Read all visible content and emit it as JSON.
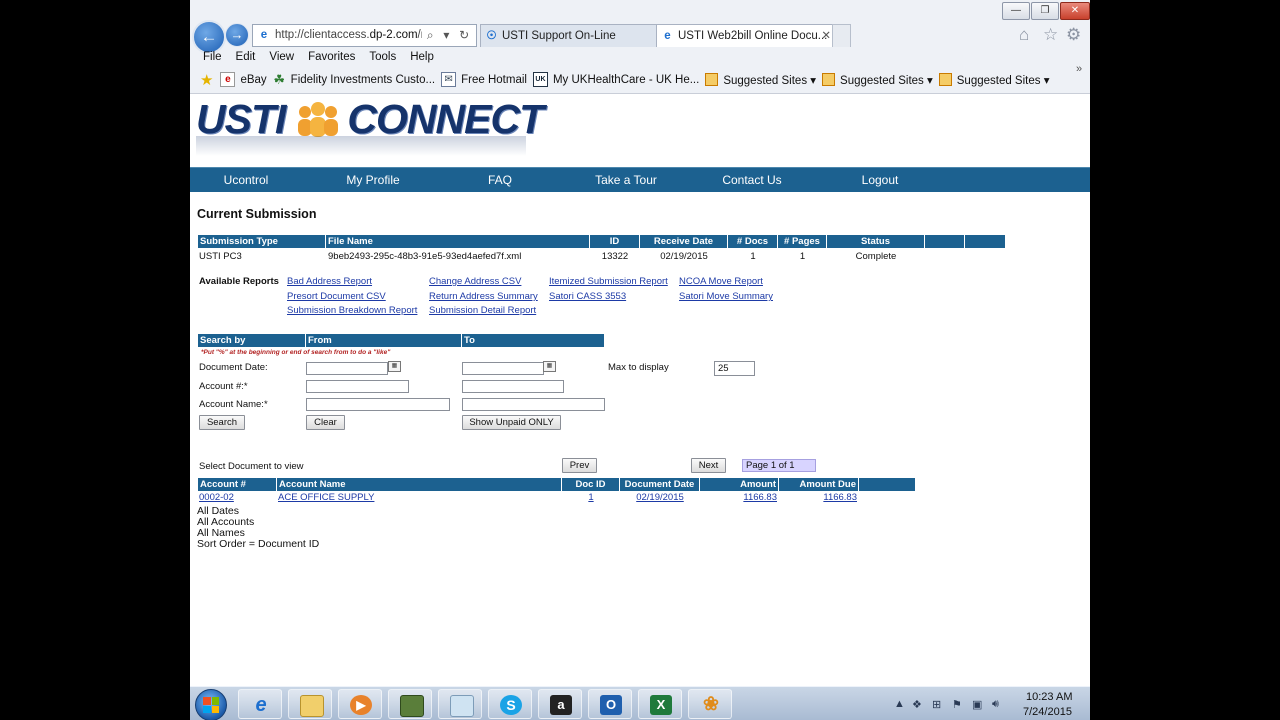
{
  "browser": {
    "address": {
      "prefix": "http://clientaccess.",
      "domain": "dp-2.com",
      "suffix": "/rp"
    },
    "tabs": [
      {
        "label": "USTI Support On-Line"
      },
      {
        "label": "USTI Web2bill Online Docu..."
      }
    ],
    "window_controls": {
      "minimize": "—",
      "maximize": "❐",
      "close": "✕"
    },
    "menu": [
      "File",
      "Edit",
      "View",
      "Favorites",
      "Tools",
      "Help"
    ],
    "favorites": [
      {
        "label": "eBay",
        "icon": "ebay-icon"
      },
      {
        "label": "Fidelity Investments Custo...",
        "icon": "fidelity-icon"
      },
      {
        "label": "Free Hotmail",
        "icon": "hotmail-icon"
      },
      {
        "label": "My UKHealthCare - UK He...",
        "icon": "ukhealthcare-icon"
      },
      {
        "label": "Suggested Sites ▾",
        "icon": "suggested-sites-icon"
      },
      {
        "label": "Suggested Sites ▾",
        "icon": "suggested-sites-icon"
      },
      {
        "label": "Suggested Sites ▾",
        "icon": "suggested-sites-icon"
      }
    ]
  },
  "site": {
    "logo": {
      "left": "USTI",
      "right": "CONNECT"
    },
    "nav": [
      "Ucontrol",
      "My Profile",
      "FAQ",
      "Take a Tour",
      "Contact Us",
      "Logout"
    ],
    "current_title": "Current Submission",
    "submission_headers": [
      "Submission Type",
      "File Name",
      "ID",
      "Receive Date",
      "# Docs",
      "# Pages",
      "Status",
      "",
      ""
    ],
    "submission_row": {
      "type": "USTI PC3",
      "file": "9beb2493-295c-48b3-91e5-93ed4aefed7f.xml",
      "id": "13322",
      "date": "02/19/2015",
      "docs": "1",
      "pages": "1",
      "status": "Complete"
    },
    "reports_label": "Available Reports",
    "reports": [
      "Bad Address Report",
      "Change Address CSV",
      "Itemized Submission Report",
      "NCOA Move Report",
      "Presort Document CSV",
      "Return Address Summary",
      "Satori CASS 3553",
      "Satori Move Summary",
      "Submission Breakdown Report",
      "Submission Detail Report"
    ],
    "search": {
      "headers": [
        "Search by",
        "From",
        "To"
      ],
      "note": "*Put \"%\" at the beginning or end of search from to do a \"like\"",
      "labels": [
        "Document Date:",
        "Account #:*",
        "Account Name:*"
      ],
      "max_label": "Max to display",
      "max_value": "25",
      "buttons": {
        "search": "Search",
        "clear": "Clear",
        "unpaid": "Show Unpaid ONLY"
      }
    },
    "results": {
      "select_label": "Select Document to view",
      "prev": "Prev",
      "next": "Next",
      "page": "Page 1 of 1",
      "headers": [
        "Account #",
        "Account Name",
        "Doc ID",
        "Document Date",
        "Amount",
        "Amount Due"
      ],
      "rows": [
        {
          "account": "0002-02",
          "name": "ACE OFFICE SUPPLY",
          "doc_id": "1",
          "date": "02/19/2015",
          "amount": "1166.83",
          "due": "1166.83"
        }
      ],
      "filters": [
        "All Dates",
        "All Accounts",
        "All Names",
        "Sort Order = Document ID"
      ]
    }
  },
  "taskbar": {
    "apps": [
      "Internet Explorer",
      "File Explorer",
      "Media Player",
      "Desktop App",
      "Folder",
      "Skype",
      "App",
      "Outlook",
      "Excel",
      "App"
    ],
    "time": "10:23 AM",
    "date": "7/24/2015"
  },
  "colors": {
    "nav_blue": "#1c6190",
    "link": "#1d3aa6",
    "logo_navy": "#15336b",
    "logo_orange": "#f0a030"
  }
}
